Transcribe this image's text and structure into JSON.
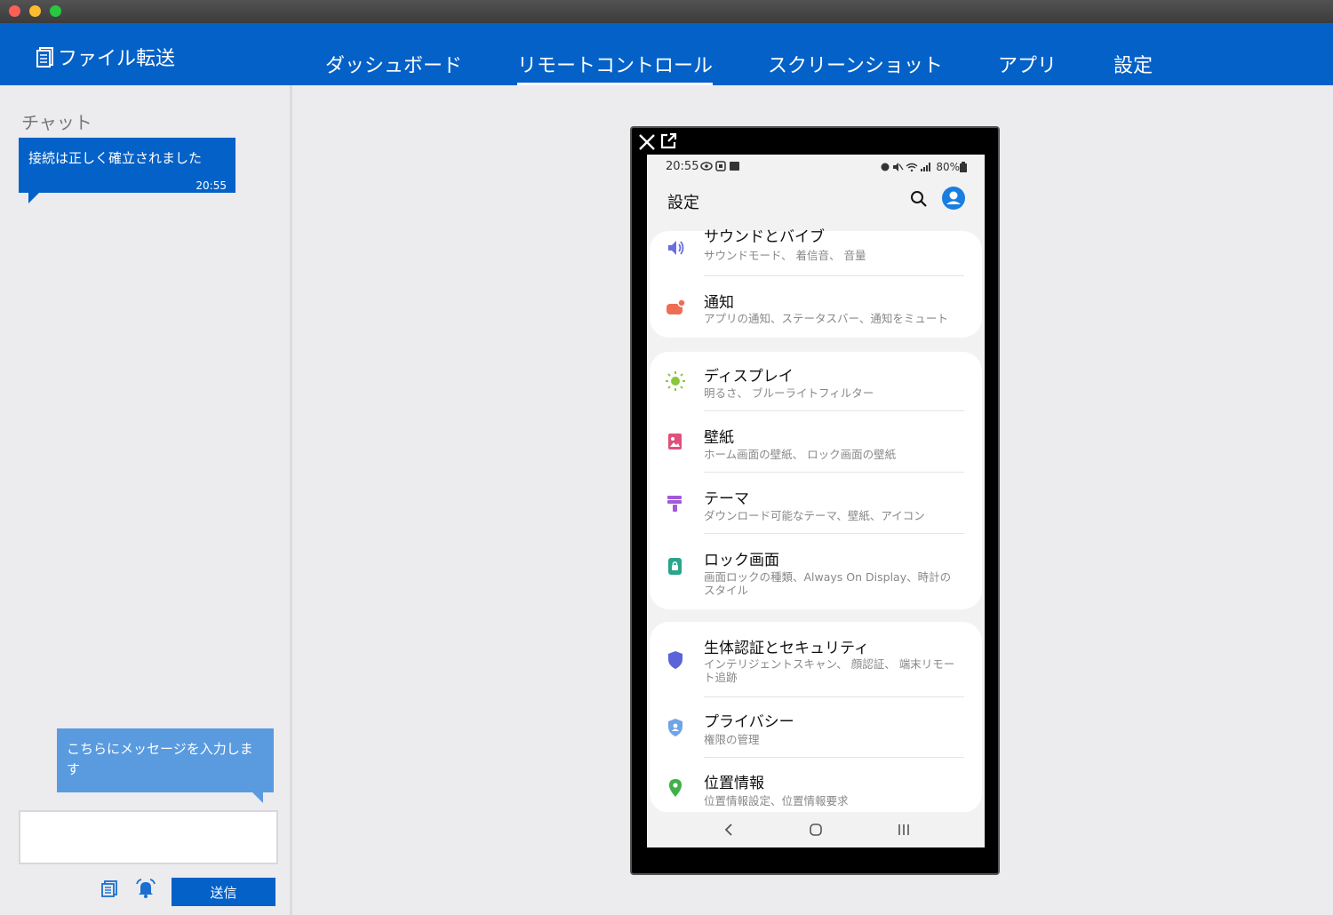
{
  "app": {
    "title": "ファイル転送"
  },
  "tabs": [
    {
      "label": "ダッシュボード",
      "active": false
    },
    {
      "label": "リモートコントロール",
      "active": true
    },
    {
      "label": "スクリーンショット",
      "active": false
    },
    {
      "label": "アプリ",
      "active": false
    },
    {
      "label": "設定",
      "active": false
    }
  ],
  "chat": {
    "title": "チャット",
    "incoming": {
      "text": "接続は正しく確立されました",
      "time": "20:55"
    },
    "outgoing": {
      "text": "こちらにメッセージを入力します"
    },
    "send_label": "送信",
    "icons": [
      "file-transfer-icon",
      "alarm-bell-icon"
    ]
  },
  "phone": {
    "status": {
      "time": "20:55",
      "battery": "80%"
    },
    "title": "設定",
    "items": [
      {
        "title": "サウンドとバイブ",
        "subtitle": "サウンドモード、 着信音、 音量",
        "icon": "sound-icon"
      },
      {
        "title": "通知",
        "subtitle": "アプリの通知、ステータスバー、通知をミュート",
        "icon": "notification-icon"
      },
      {
        "title": "ディスプレイ",
        "subtitle": "明るさ、 ブルーライトフィルター",
        "icon": "display-icon"
      },
      {
        "title": "壁紙",
        "subtitle": "ホーム画面の壁紙、 ロック画面の壁紙",
        "icon": "wallpaper-icon"
      },
      {
        "title": "テーマ",
        "subtitle": "ダウンロード可能なテーマ、壁紙、アイコン",
        "icon": "theme-icon"
      },
      {
        "title": "ロック画面",
        "subtitle": "画面ロックの種類、Always On Display、時計のスタイル",
        "icon": "lock-screen-icon"
      },
      {
        "title": "生体認証とセキュリティ",
        "subtitle": "インテリジェントスキャン、 顔認証、 端末リモート追跡",
        "icon": "security-icon"
      },
      {
        "title": "プライバシー",
        "subtitle": "権限の管理",
        "icon": "privacy-icon"
      },
      {
        "title": "位置情報",
        "subtitle": "位置情報設定、位置情報要求",
        "icon": "location-icon"
      }
    ]
  },
  "colors": {
    "brand": "#0461c8",
    "bubble_out": "#5a9be0",
    "background": "#ececee"
  }
}
